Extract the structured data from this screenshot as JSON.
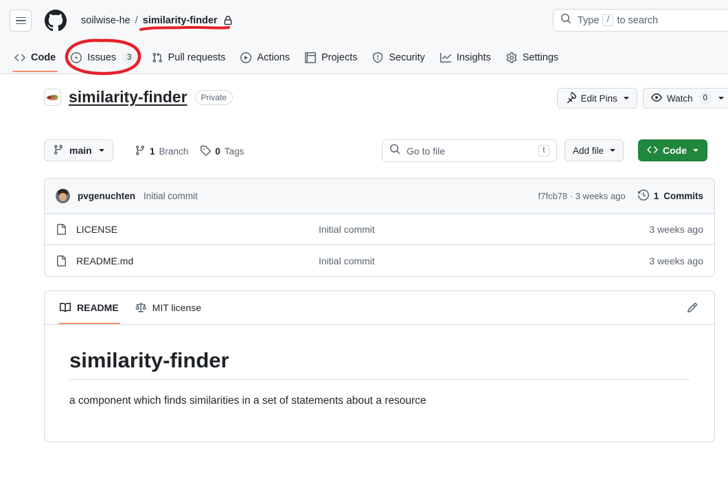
{
  "header": {
    "menu_label": "Open menu",
    "logo_name": "github-logo",
    "breadcrumb": {
      "owner": "soilwise-he",
      "separator": "/",
      "repo": "similarity-finder",
      "visibility_icon": "lock-icon"
    },
    "search": {
      "placeholder_before": "Type",
      "key_hint": "/",
      "placeholder_after": "to search",
      "icon": "search-icon"
    }
  },
  "nav_tabs": [
    {
      "label": "Code",
      "icon": "code-icon",
      "count": "",
      "active": true
    },
    {
      "label": "Issues",
      "icon": "issue-opened-icon",
      "count": "3",
      "active": false
    },
    {
      "label": "Pull requests",
      "icon": "git-pull-request-icon",
      "count": "",
      "active": false
    },
    {
      "label": "Actions",
      "icon": "play-icon",
      "count": "",
      "active": false
    },
    {
      "label": "Projects",
      "icon": "table-icon",
      "count": "",
      "active": false
    },
    {
      "label": "Security",
      "icon": "shield-icon",
      "count": "",
      "active": false
    },
    {
      "label": "Insights",
      "icon": "graph-icon",
      "count": "",
      "active": false
    },
    {
      "label": "Settings",
      "icon": "gear-icon",
      "count": "",
      "active": false
    }
  ],
  "repo": {
    "avatar_name": "org-avatar",
    "name": "similarity-finder",
    "visibility_badge": "Private",
    "edit_pins_label": "Edit Pins",
    "edit_pins_icon": "pin-icon",
    "watch_label": "Watch",
    "watch_count": "0",
    "watch_icon": "eye-icon"
  },
  "toolbar": {
    "branch_name": "main",
    "branch_icon": "git-branch-icon",
    "branch_count_value": "1",
    "branch_count_label": "Branch",
    "tags_count_value": "0",
    "tags_count_label": "Tags",
    "tag_icon": "tag-icon",
    "go_to_file_placeholder": "Go to file",
    "go_to_file_key": "t",
    "go_to_file_icon": "search-icon",
    "add_file_label": "Add file",
    "code_label": "Code",
    "code_icon": "code-icon"
  },
  "commit_bar": {
    "avatar_name": "user-avatar",
    "author": "pvgenuchten",
    "message": "Initial commit",
    "hash_and_time": "f7fcb78 · 3 weeks ago",
    "commits_count": "1",
    "commits_label": "Commits",
    "history_icon": "history-icon"
  },
  "files": [
    {
      "icon": "file-icon",
      "name": "LICENSE",
      "message": "Initial commit",
      "age": "3 weeks ago"
    },
    {
      "icon": "file-icon",
      "name": "README.md",
      "message": "Initial commit",
      "age": "3 weeks ago"
    }
  ],
  "readme": {
    "tabs": [
      {
        "label": "README",
        "icon": "book-icon",
        "active": true
      },
      {
        "label": "MIT license",
        "icon": "law-icon",
        "active": false
      }
    ],
    "edit_icon": "pencil-icon",
    "heading": "similarity-finder",
    "paragraph": "a component which finds similarities in a set of statements about a resource"
  },
  "annotations": [
    {
      "name": "red-underline-repo-name",
      "shape": "underline",
      "color": "#e8202a"
    },
    {
      "name": "red-ellipse-issues-tab",
      "shape": "ellipse",
      "color": "#e8202a"
    }
  ],
  "colors": {
    "accent_green": "#1f883d",
    "tab_underline": "#fd8c73",
    "annotation_red": "#e8202a",
    "header_bg": "#f6f8fa",
    "border": "#d1d9e0",
    "muted_text": "#59636e"
  }
}
